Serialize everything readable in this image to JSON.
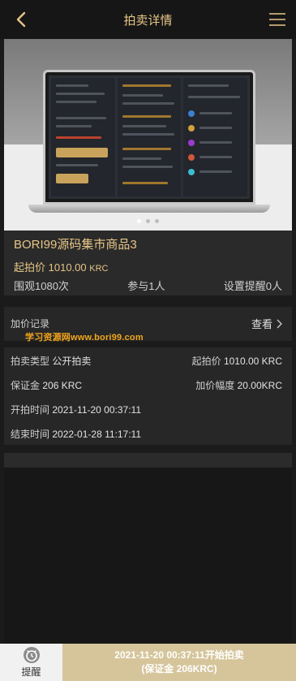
{
  "header": {
    "title": "拍卖详情",
    "back_icon": "chevron-left-icon",
    "menu_icon": "hamburger-menu-icon"
  },
  "banner": {
    "slides": 3,
    "active_slide": 1
  },
  "product": {
    "name": "BORI99源码集市商品3",
    "start_price_label": "起拍价",
    "start_price": "1010.00",
    "unit": "KRC",
    "views": "围观1080次",
    "participants": "参与1人",
    "reminders": "设置提醒0人"
  },
  "records": {
    "label": "加价记录",
    "view_label": "查看",
    "watermark": "学习资源网www.bori99.com"
  },
  "details": {
    "type_label": "拍卖类型",
    "type_value": "公开拍卖",
    "start_price_label": "起拍价",
    "start_price_value": "1010.00 KRC",
    "deposit_label": "保证金",
    "deposit_value": "206 KRC",
    "increment_label": "加价幅度",
    "increment_value": "20.00KRC",
    "start_time_label": "开拍时间",
    "start_time_value": "2021-11-20 00:37:11",
    "end_time_label": "结束时间",
    "end_time_value": "2022-01-28 11:17:11"
  },
  "footer": {
    "remind_label": "提醒",
    "cta_line1": "2021-11-20 00:37:11开始拍卖",
    "cta_line2": "(保证金 206KRC)"
  },
  "colors": {
    "accent": "#e6c587",
    "cta_bg": "#d6c59b",
    "watermark": "#f3a51b"
  }
}
